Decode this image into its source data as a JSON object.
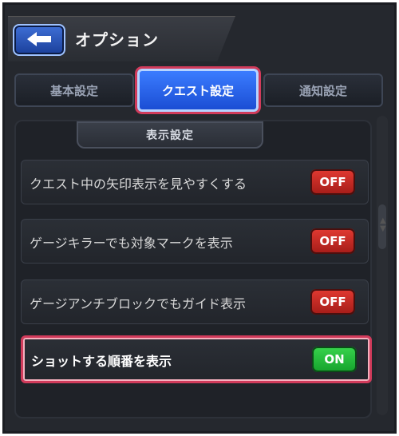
{
  "header": {
    "title": "オプション"
  },
  "tabs": [
    {
      "label": "基本設定"
    },
    {
      "label": "クエスト設定"
    },
    {
      "label": "通知設定"
    }
  ],
  "section": {
    "title": "表示設定"
  },
  "rows": [
    {
      "label": "クエスト中の矢印表示を見やすくする",
      "toggle": "OFF"
    },
    {
      "label": "ゲージキラーでも対象マークを表示",
      "toggle": "OFF"
    },
    {
      "label": "ゲージアンチブロックでもガイド表示",
      "toggle": "OFF"
    },
    {
      "label": "ショットする順番を表示",
      "toggle": "ON"
    }
  ],
  "colors": {
    "active_tab": "#2f64f0",
    "highlight": "#d13b5b",
    "off": "#c52a24",
    "on": "#22b93a"
  },
  "icons": {
    "back": "back-arrow-icon",
    "scroll": "scroll-arrows-icon"
  }
}
